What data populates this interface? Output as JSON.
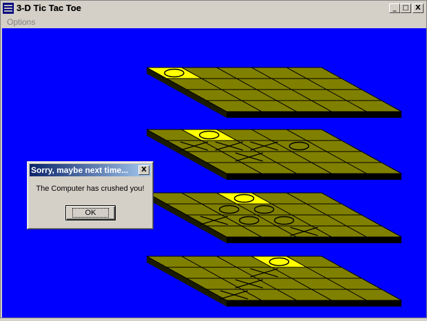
{
  "window": {
    "title": "3-D Tic Tac Toe",
    "minimize_label": "_",
    "maximize_label": "□",
    "close_label": "X"
  },
  "menu": {
    "items": [
      {
        "label": "Options"
      }
    ]
  },
  "colors": {
    "background": "#0000ff",
    "board": "#808000",
    "board_edge": "#000000",
    "highlight": "#ffff00",
    "grid_line": "#000000"
  },
  "game": {
    "boards": [
      {
        "level": 1,
        "cells": [
          [
            "O",
            "",
            "",
            "",
            ""
          ],
          [
            "",
            "",
            "",
            "",
            ""
          ],
          [
            "",
            "",
            "",
            "",
            ""
          ],
          [
            "",
            "",
            "",
            "",
            ""
          ]
        ],
        "highlight": [
          [
            0,
            0
          ]
        ]
      },
      {
        "level": 2,
        "cells": [
          [
            "",
            "O",
            "",
            "",
            ""
          ],
          [
            "X",
            "X",
            "X",
            "O",
            ""
          ],
          [
            "",
            "X",
            "",
            "",
            ""
          ],
          [
            "",
            "",
            "",
            "",
            ""
          ]
        ],
        "highlight": [
          [
            0,
            1
          ]
        ]
      },
      {
        "level": 3,
        "cells": [
          [
            "",
            "",
            "O",
            "",
            ""
          ],
          [
            "",
            "O",
            "O",
            "",
            ""
          ],
          [
            "X",
            "O",
            "O",
            "",
            ""
          ],
          [
            "",
            "",
            "X",
            "",
            ""
          ]
        ],
        "highlight": [
          [
            0,
            2
          ]
        ]
      },
      {
        "level": 4,
        "cells": [
          [
            "",
            "",
            "",
            "O",
            ""
          ],
          [
            "",
            "",
            "X",
            "",
            ""
          ],
          [
            "",
            "X",
            "",
            "",
            ""
          ],
          [
            "X",
            "",
            "",
            "",
            ""
          ]
        ],
        "highlight": [
          [
            0,
            3
          ]
        ]
      }
    ]
  },
  "dialog": {
    "title": "Sorry, maybe next time...",
    "message": "The Computer has crushed you!",
    "ok_label": "OK",
    "close_label": "X"
  }
}
